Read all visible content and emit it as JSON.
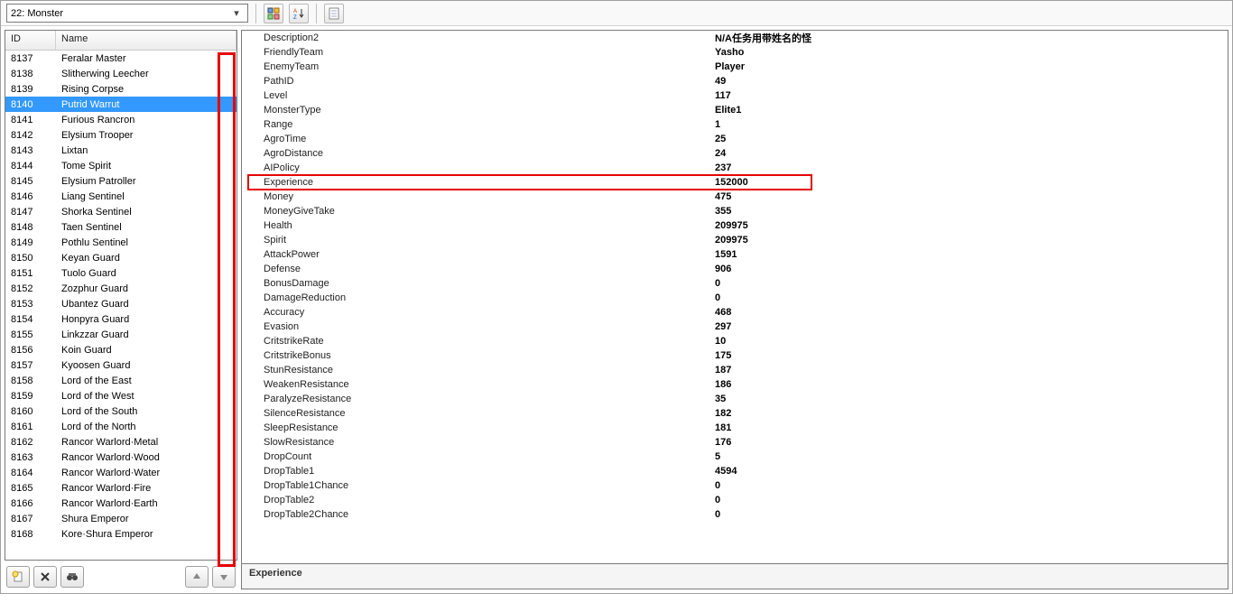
{
  "toolbar": {
    "combo_text": "22: Monster"
  },
  "list_headers": {
    "id": "ID",
    "name": "Name"
  },
  "selected_id": "8140",
  "monsters": [
    {
      "id": "8137",
      "name": "Feralar Master"
    },
    {
      "id": "8138",
      "name": "Slitherwing Leecher"
    },
    {
      "id": "8139",
      "name": "Rising Corpse"
    },
    {
      "id": "8140",
      "name": "Putrid Warrut"
    },
    {
      "id": "8141",
      "name": "Furious Rancron"
    },
    {
      "id": "8142",
      "name": "Elysium Trooper"
    },
    {
      "id": "8143",
      "name": "Lixtan"
    },
    {
      "id": "8144",
      "name": "Tome Spirit"
    },
    {
      "id": "8145",
      "name": "Elysium Patroller"
    },
    {
      "id": "8146",
      "name": "Liang Sentinel"
    },
    {
      "id": "8147",
      "name": "Shorka Sentinel"
    },
    {
      "id": "8148",
      "name": "Taen Sentinel"
    },
    {
      "id": "8149",
      "name": "Pothlu Sentinel"
    },
    {
      "id": "8150",
      "name": "Keyan Guard"
    },
    {
      "id": "8151",
      "name": "Tuolo Guard"
    },
    {
      "id": "8152",
      "name": "Zozphur Guard"
    },
    {
      "id": "8153",
      "name": "Ubantez Guard"
    },
    {
      "id": "8154",
      "name": "Honpyra Guard"
    },
    {
      "id": "8155",
      "name": "Linkzzar Guard"
    },
    {
      "id": "8156",
      "name": "Koin Guard"
    },
    {
      "id": "8157",
      "name": "Kyoosen Guard"
    },
    {
      "id": "8158",
      "name": "Lord of the East"
    },
    {
      "id": "8159",
      "name": "Lord of the West"
    },
    {
      "id": "8160",
      "name": "Lord of the South"
    },
    {
      "id": "8161",
      "name": "Lord of the North"
    },
    {
      "id": "8162",
      "name": "Rancor Warlord·Metal"
    },
    {
      "id": "8163",
      "name": "Rancor Warlord·Wood"
    },
    {
      "id": "8164",
      "name": "Rancor Warlord·Water"
    },
    {
      "id": "8165",
      "name": "Rancor Warlord·Fire"
    },
    {
      "id": "8166",
      "name": "Rancor Warlord·Earth"
    },
    {
      "id": "8167",
      "name": "Shura Emperor"
    },
    {
      "id": "8168",
      "name": "Kore·Shura Emperor"
    }
  ],
  "props": [
    {
      "name": "Description2",
      "value": "N/A任务用带姓名的怪"
    },
    {
      "name": "FriendlyTeam",
      "value": "Yasho"
    },
    {
      "name": "EnemyTeam",
      "value": "Player"
    },
    {
      "name": "PathID",
      "value": "49"
    },
    {
      "name": "Level",
      "value": "117"
    },
    {
      "name": "MonsterType",
      "value": "Elite1"
    },
    {
      "name": "Range",
      "value": "1"
    },
    {
      "name": "AgroTime",
      "value": "25"
    },
    {
      "name": "AgroDistance",
      "value": "24"
    },
    {
      "name": "AIPolicy",
      "value": "237"
    },
    {
      "name": "Experience",
      "value": "152000",
      "highlight": true
    },
    {
      "name": "Money",
      "value": "475"
    },
    {
      "name": "MoneyGiveTake",
      "value": "355"
    },
    {
      "name": "Health",
      "value": "209975"
    },
    {
      "name": "Spirit",
      "value": "209975"
    },
    {
      "name": "AttackPower",
      "value": "1591"
    },
    {
      "name": "Defense",
      "value": "906"
    },
    {
      "name": "BonusDamage",
      "value": "0"
    },
    {
      "name": "DamageReduction",
      "value": "0"
    },
    {
      "name": "Accuracy",
      "value": "468"
    },
    {
      "name": "Evasion",
      "value": "297"
    },
    {
      "name": "CritstrikeRate",
      "value": "10"
    },
    {
      "name": "CritstrikeBonus",
      "value": "175"
    },
    {
      "name": "StunResistance",
      "value": "187"
    },
    {
      "name": "WeakenResistance",
      "value": "186"
    },
    {
      "name": "ParalyzeResistance",
      "value": "35"
    },
    {
      "name": "SilenceResistance",
      "value": "182"
    },
    {
      "name": "SleepResistance",
      "value": "181"
    },
    {
      "name": "SlowResistance",
      "value": "176"
    },
    {
      "name": "DropCount",
      "value": "5"
    },
    {
      "name": "DropTable1",
      "value": "4594"
    },
    {
      "name": "DropTable1Chance",
      "value": "0"
    },
    {
      "name": "DropTable2",
      "value": "0"
    },
    {
      "name": "DropTable2Chance",
      "value": "0"
    }
  ],
  "description_pane": "Experience"
}
